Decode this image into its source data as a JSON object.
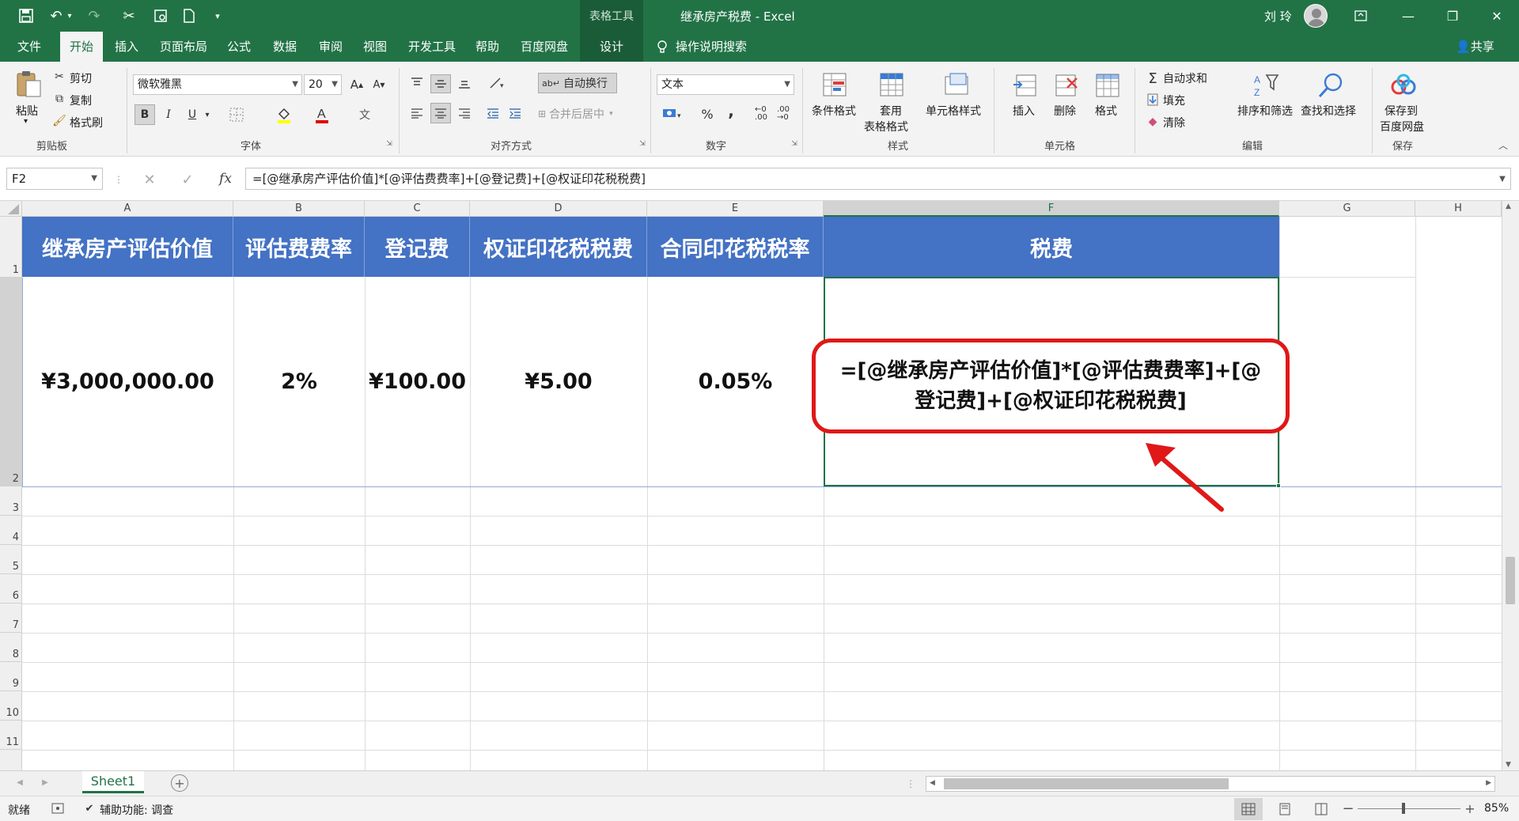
{
  "window": {
    "title": "继承房产税费  -  Excel",
    "context_tools": "表格工具",
    "user_name": "刘 玲",
    "colors": {
      "accent": "#217346",
      "header_fill": "#4472c4",
      "callout": "#e01818"
    }
  },
  "tabs": [
    "文件",
    "开始",
    "插入",
    "页面布局",
    "公式",
    "数据",
    "审阅",
    "视图",
    "开发工具",
    "帮助",
    "百度网盘",
    "设计"
  ],
  "tell_me": "操作说明搜索",
  "share": "共享",
  "ribbon": {
    "clipboard": {
      "label": "剪贴板",
      "paste": "粘贴",
      "cut": "剪切",
      "copy": "复制",
      "format_painter": "格式刷"
    },
    "font": {
      "label": "字体",
      "name": "微软雅黑",
      "size": "20",
      "bold": "B",
      "italic": "I",
      "underline": "U"
    },
    "alignment": {
      "label": "对齐方式",
      "wrap": "自动换行",
      "merge": "合并后居中"
    },
    "number": {
      "label": "数字",
      "format": "文本",
      "percent": "%",
      "comma": ","
    },
    "styles": {
      "label": "样式",
      "conditional": "条件格式",
      "table_a": "套用",
      "table_b": "表格格式",
      "cell_styles": "单元格样式"
    },
    "cells": {
      "label": "单元格",
      "insert": "插入",
      "delete": "删除",
      "format": "格式"
    },
    "editing": {
      "label": "编辑",
      "autosum": "自动求和",
      "fill": "填充",
      "clear": "清除",
      "sort": "排序和筛选",
      "find": "查找和选择"
    },
    "save": {
      "label": "保存",
      "save_a": "保存到",
      "save_b": "百度网盘"
    }
  },
  "formula_bar": {
    "name_box": "F2",
    "fx": "fx",
    "formula": "=[@继承房产评估价值]*[@评估费费率]+[@登记费]+[@权证印花税税费]"
  },
  "columns": [
    "A",
    "B",
    "C",
    "D",
    "E",
    "F",
    "G",
    "H"
  ],
  "rows": [
    "1",
    "2",
    "3",
    "4",
    "5",
    "6",
    "7",
    "8",
    "9",
    "10",
    "11"
  ],
  "table": {
    "headers": [
      "继承房产评估价值",
      "评估费费率",
      "登记费",
      "权证印花税税费",
      "合同印花税税率",
      "税费"
    ],
    "row": [
      "¥3,000,000.00",
      "2%",
      "¥100.00",
      "¥5.00",
      "0.05%"
    ],
    "f2_line1": "=[@继承房产评估价值]*[@评估费费率]+[@",
    "f2_line2": "登记费]+[@权证印花税税费]"
  },
  "sheet_tab": "Sheet1",
  "status": {
    "ready": "就绪",
    "accessibility": "辅助功能: 调查",
    "zoom": "85%"
  }
}
